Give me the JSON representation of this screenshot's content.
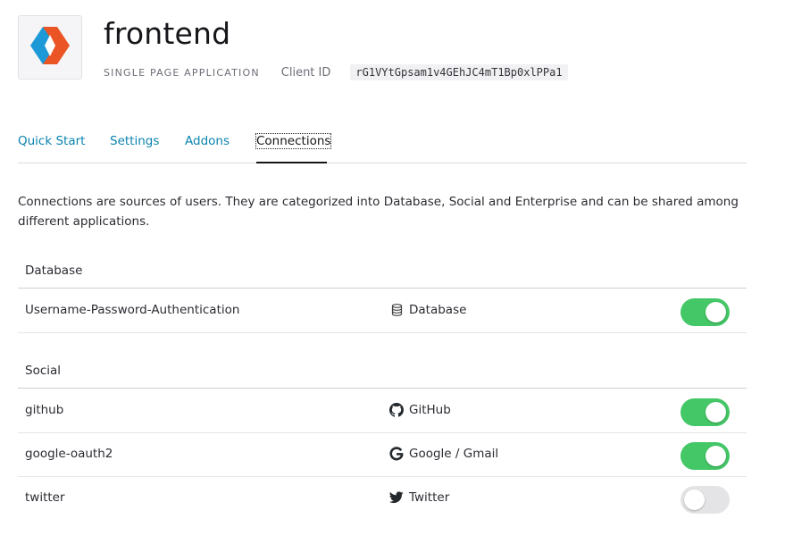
{
  "app": {
    "name": "frontend",
    "type": "SINGLE PAGE APPLICATION",
    "client_id_label": "Client ID",
    "client_id": "rG1VYtGpsam1v4GEhJC4mT1Bp0xlPPa1",
    "logo_icon": "app-logo-icon"
  },
  "tabs": [
    {
      "label": "Quick Start",
      "active": false
    },
    {
      "label": "Settings",
      "active": false
    },
    {
      "label": "Addons",
      "active": false
    },
    {
      "label": "Connections",
      "active": true
    }
  ],
  "description": "Connections are sources of users. They are categorized into Database, Social and Enterprise and can be shared among different applications.",
  "sections": [
    {
      "title": "Database",
      "connections": [
        {
          "name": "Username-Password-Authentication",
          "strategy": "Database",
          "icon": "database-icon",
          "enabled": true
        }
      ]
    },
    {
      "title": "Social",
      "connections": [
        {
          "name": "github",
          "strategy": "GitHub",
          "icon": "github-icon",
          "enabled": true
        },
        {
          "name": "google-oauth2",
          "strategy": "Google / Gmail",
          "icon": "google-icon",
          "enabled": true
        },
        {
          "name": "twitter",
          "strategy": "Twitter",
          "icon": "twitter-icon",
          "enabled": false
        }
      ]
    }
  ],
  "colors": {
    "link": "#0a84ae",
    "toggle_on": "#44c767",
    "toggle_off": "#e4e4e6",
    "logo_blue": "#1c99d6",
    "logo_orange": "#eb5424"
  }
}
